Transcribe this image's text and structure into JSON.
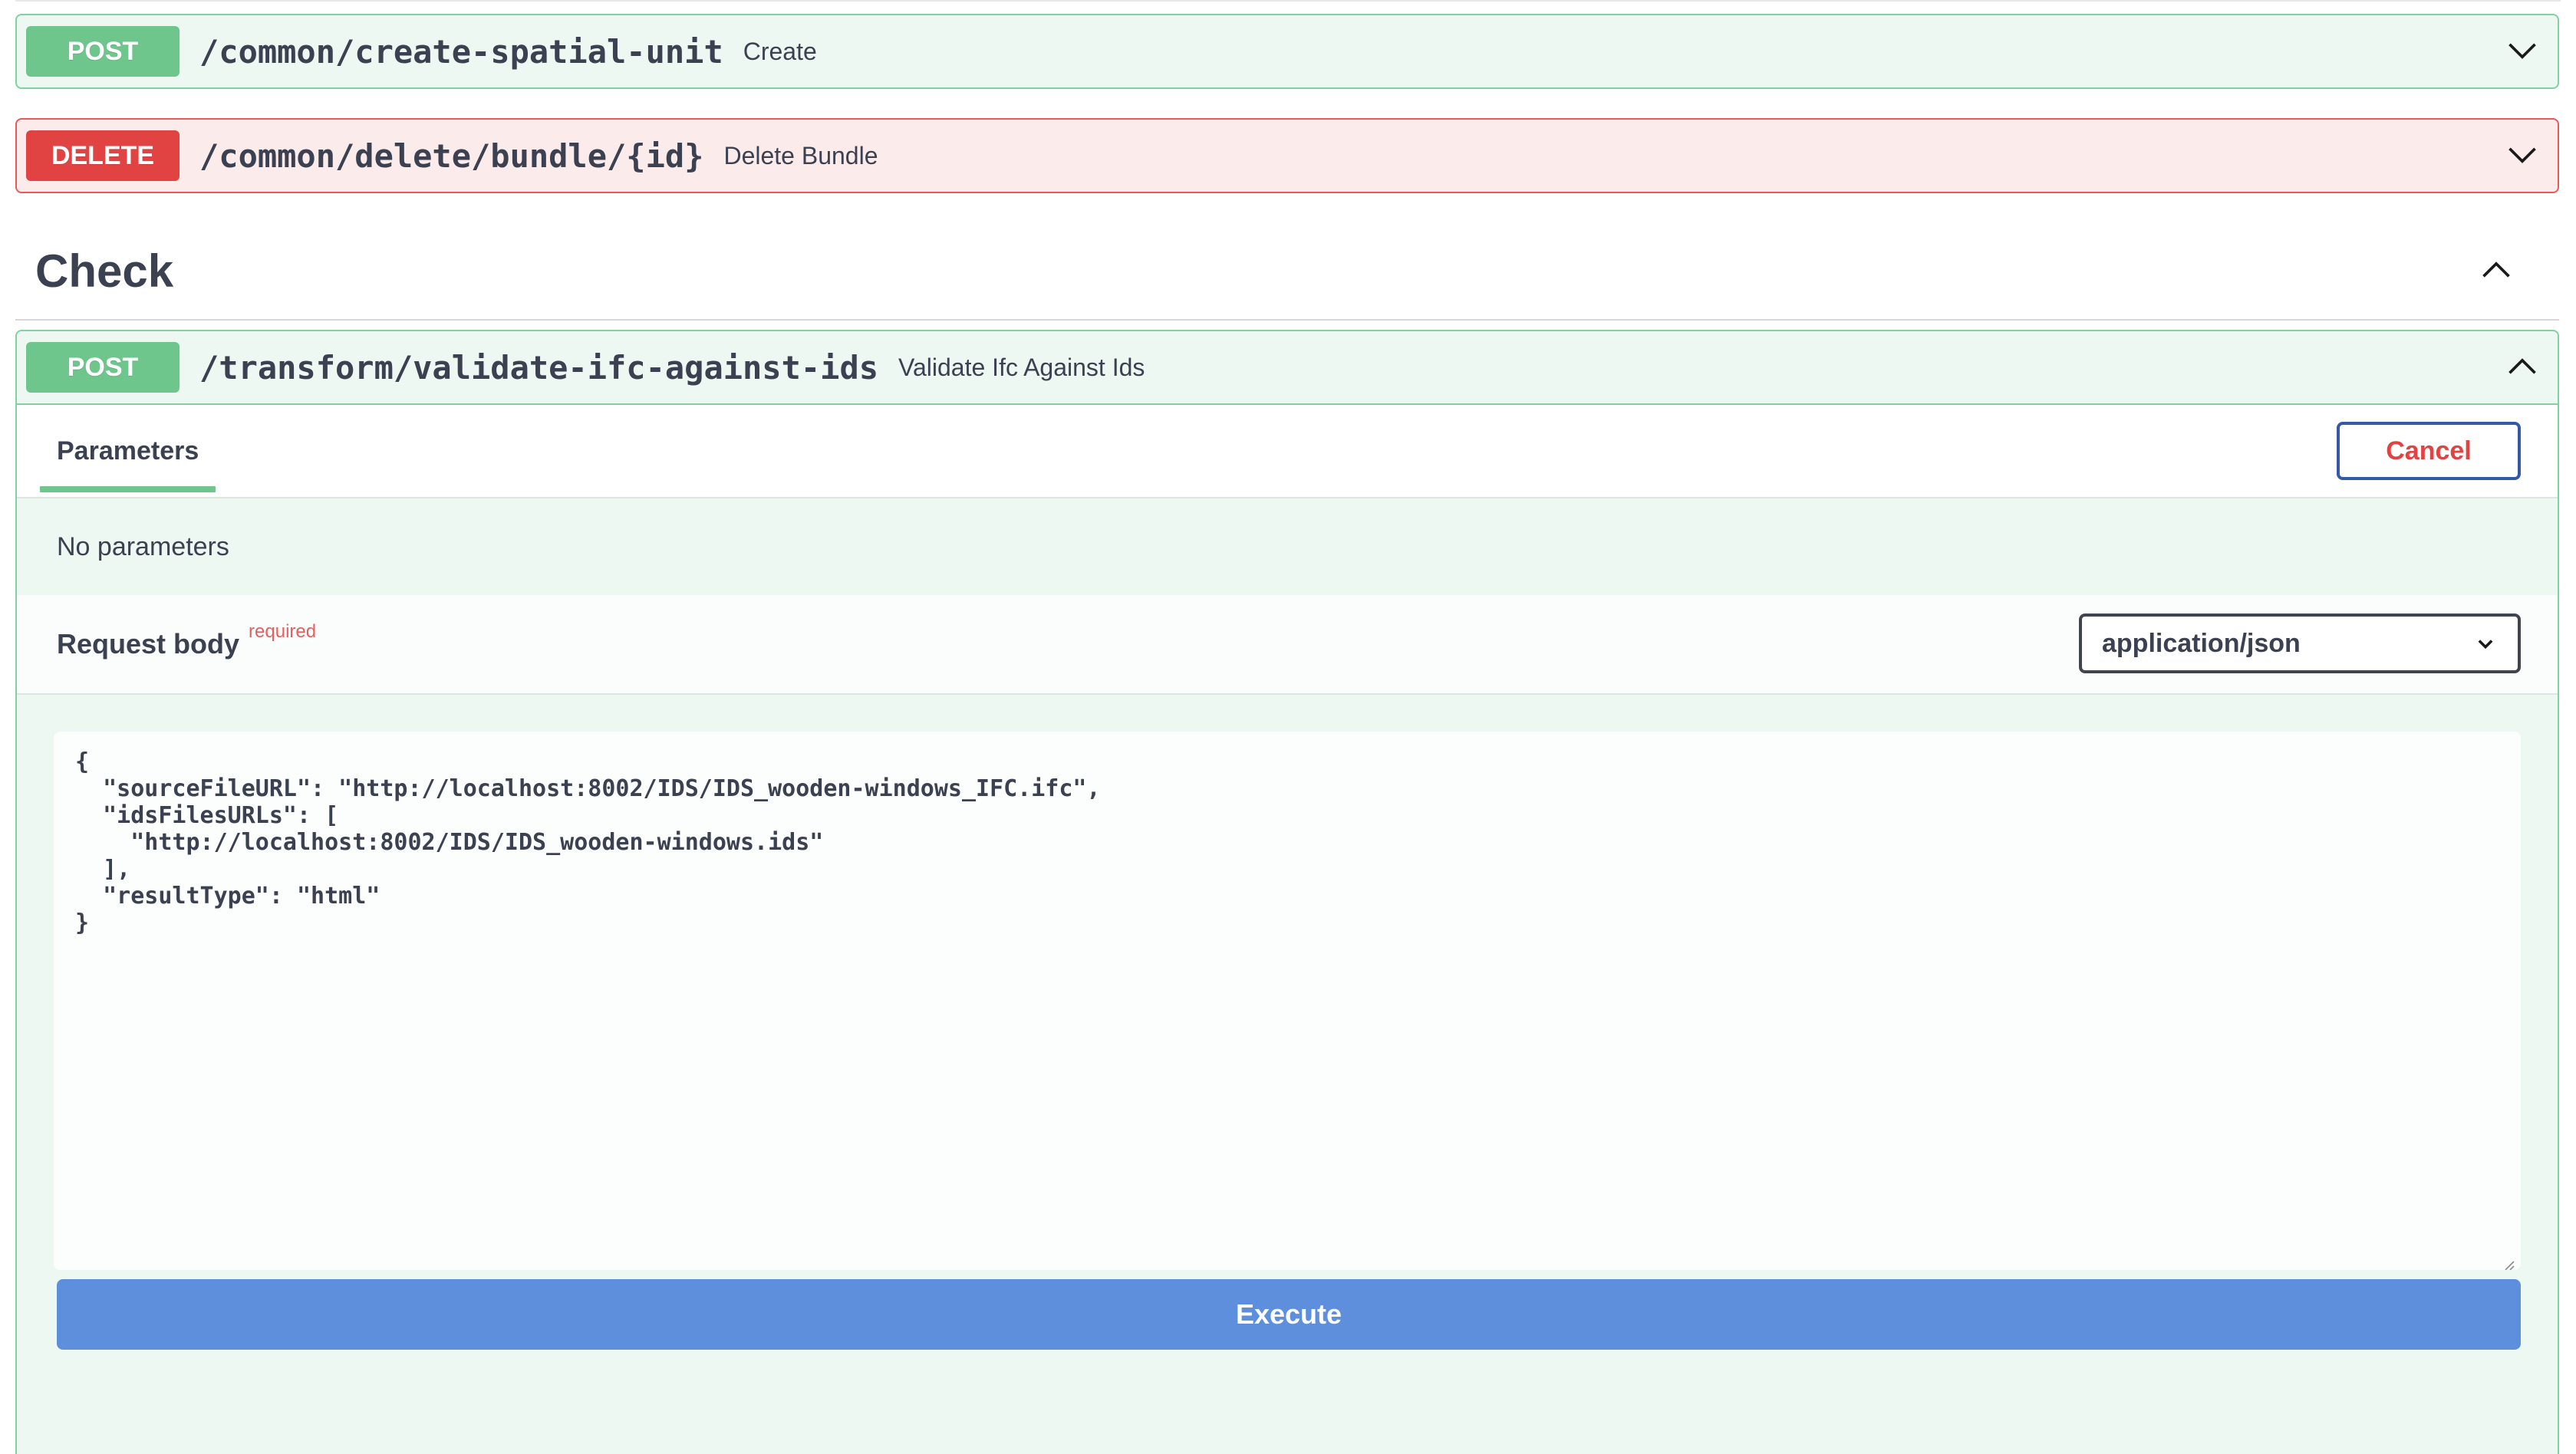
{
  "operations": {
    "create_spatial_unit": {
      "method": "POST",
      "path": "/common/create-spatial-unit",
      "summary": "Create"
    },
    "delete_bundle": {
      "method": "DELETE",
      "path": "/common/delete/bundle/{id}",
      "summary": "Delete Bundle"
    }
  },
  "tag": {
    "title": "Check"
  },
  "expanded_operation": {
    "method": "POST",
    "path": "/transform/validate-ifc-against-ids",
    "summary": "Validate Ifc Against Ids",
    "tab_label": "Parameters",
    "cancel_label": "Cancel",
    "no_params_text": "No parameters",
    "request_body_label": "Request body",
    "required_label": "required",
    "content_type": "application/json",
    "request_body": "{\n  \"sourceFileURL\": \"http://localhost:8002/IDS/IDS_wooden-windows_IFC.ifc\",\n  \"idsFilesURLs\": [\n    \"http://localhost:8002/IDS/IDS_wooden-windows.ids\"\n  ],\n  \"resultType\": \"html\"\n}",
    "execute_label": "Execute"
  },
  "icons": {
    "collapse": "chevron-down-icon",
    "expand": "chevron-up-icon"
  },
  "colors": {
    "post": "#6ec68c",
    "delete": "#e14343",
    "execute": "#5e8fdc",
    "cancel_border": "#3457a8"
  }
}
